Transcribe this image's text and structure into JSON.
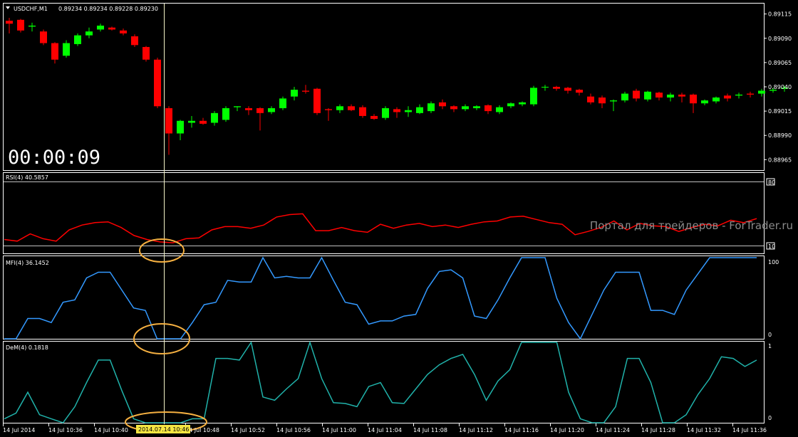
{
  "header": {
    "symbol": "USDCHF,M1",
    "ohlc": "0.89234 0.89234 0.89228 0.89230"
  },
  "timer": "00:00:09",
  "watermark": "Портал для трейдеров - ForTrader.ru",
  "crosshair_date": "2014.07.14 10:46",
  "colors": {
    "background": "#000000",
    "bull": "#00ff00",
    "bear": "#ff0000",
    "rsi": "#ff0000",
    "mfi": "#3399ff",
    "dem": "#20b2aa",
    "crosshair": "#f5f5c8",
    "highlight": "#f5b041"
  },
  "price_axis": [
    "0.89115",
    "0.89090",
    "0.89065",
    "0.89040",
    "0.89015",
    "0.88990",
    "0.88965"
  ],
  "time_axis": [
    "14 Jul 2014",
    "14 Jul 10:36",
    "14 Jul 10:40",
    "14 Jul 10:48",
    "14 Jul 10:52",
    "14 Jul 10:56",
    "14 Jul 11:00",
    "14 Jul 11:04",
    "14 Jul 11:08",
    "14 Jul 11:12",
    "14 Jul 11:16",
    "14 Jul 11:20",
    "14 Jul 11:24",
    "14 Jul 11:28",
    "14 Jul 11:32",
    "14 Jul 11:36"
  ],
  "rsi": {
    "label": "RSI(4) 40.5857",
    "levels": [
      "80",
      "10"
    ]
  },
  "mfi": {
    "label": "MFI(4) 36.1452",
    "levels": [
      "100",
      "0"
    ]
  },
  "dem": {
    "label": "DeM(4) 0.1818",
    "levels": [
      "1",
      "0"
    ]
  },
  "chart_data": [
    {
      "type": "candlestick",
      "title": "USDCHF,M1",
      "ylim": [
        0.88955,
        0.89125
      ],
      "candles": [
        {
          "o": 0.89108,
          "h": 0.89111,
          "l": 0.89095,
          "c": 0.89105
        },
        {
          "o": 0.89109,
          "h": 0.8911,
          "l": 0.89096,
          "c": 0.89098
        },
        {
          "o": 0.89102,
          "h": 0.89106,
          "l": 0.89097,
          "c": 0.89103
        },
        {
          "o": 0.89097,
          "h": 0.89099,
          "l": 0.89083,
          "c": 0.89085
        },
        {
          "o": 0.89085,
          "h": 0.89086,
          "l": 0.89064,
          "c": 0.89068
        },
        {
          "o": 0.89072,
          "h": 0.89088,
          "l": 0.8907,
          "c": 0.89085
        },
        {
          "o": 0.89084,
          "h": 0.89095,
          "l": 0.89082,
          "c": 0.89093
        },
        {
          "o": 0.89093,
          "h": 0.89101,
          "l": 0.8909,
          "c": 0.89097
        },
        {
          "o": 0.89099,
          "h": 0.89105,
          "l": 0.89097,
          "c": 0.89103
        },
        {
          "o": 0.89101,
          "h": 0.89102,
          "l": 0.89098,
          "c": 0.89099
        },
        {
          "o": 0.89098,
          "h": 0.891,
          "l": 0.89093,
          "c": 0.89095
        },
        {
          "o": 0.89092,
          "h": 0.89094,
          "l": 0.89081,
          "c": 0.89083
        },
        {
          "o": 0.89081,
          "h": 0.89082,
          "l": 0.89066,
          "c": 0.89068
        },
        {
          "o": 0.89068,
          "h": 0.8907,
          "l": 0.89018,
          "c": 0.8902
        },
        {
          "o": 0.89018,
          "h": 0.8902,
          "l": 0.8897,
          "c": 0.88992
        },
        {
          "o": 0.88992,
          "h": 0.89006,
          "l": 0.88985,
          "c": 0.89005
        },
        {
          "o": 0.89003,
          "h": 0.8901,
          "l": 0.88998,
          "c": 0.89005
        },
        {
          "o": 0.89005,
          "h": 0.89008,
          "l": 0.89001,
          "c": 0.89002
        },
        {
          "o": 0.89003,
          "h": 0.89015,
          "l": 0.89,
          "c": 0.89013
        },
        {
          "o": 0.89006,
          "h": 0.8902,
          "l": 0.89004,
          "c": 0.89018
        },
        {
          "o": 0.89019,
          "h": 0.8902,
          "l": 0.89015,
          "c": 0.8902
        },
        {
          "o": 0.89018,
          "h": 0.8902,
          "l": 0.89011,
          "c": 0.89016
        },
        {
          "o": 0.89018,
          "h": 0.89019,
          "l": 0.88995,
          "c": 0.89013
        },
        {
          "o": 0.89014,
          "h": 0.8902,
          "l": 0.89012,
          "c": 0.89018
        },
        {
          "o": 0.89018,
          "h": 0.8903,
          "l": 0.89016,
          "c": 0.89028
        },
        {
          "o": 0.8903,
          "h": 0.8904,
          "l": 0.89026,
          "c": 0.89037
        },
        {
          "o": 0.89036,
          "h": 0.89042,
          "l": 0.89033,
          "c": 0.89035
        },
        {
          "o": 0.89038,
          "h": 0.89039,
          "l": 0.89011,
          "c": 0.89013
        },
        {
          "o": 0.89017,
          "h": 0.89018,
          "l": 0.89005,
          "c": 0.89016
        },
        {
          "o": 0.89016,
          "h": 0.89022,
          "l": 0.89013,
          "c": 0.8902
        },
        {
          "o": 0.8902,
          "h": 0.89022,
          "l": 0.89015,
          "c": 0.89016
        },
        {
          "o": 0.89019,
          "h": 0.89021,
          "l": 0.89008,
          "c": 0.8901
        },
        {
          "o": 0.8901,
          "h": 0.89012,
          "l": 0.89006,
          "c": 0.89007
        },
        {
          "o": 0.89008,
          "h": 0.8902,
          "l": 0.89006,
          "c": 0.89018
        },
        {
          "o": 0.89017,
          "h": 0.89019,
          "l": 0.89008,
          "c": 0.89014
        },
        {
          "o": 0.89014,
          "h": 0.8902,
          "l": 0.89009,
          "c": 0.89016
        },
        {
          "o": 0.89013,
          "h": 0.89022,
          "l": 0.89012,
          "c": 0.89019
        },
        {
          "o": 0.89015,
          "h": 0.89025,
          "l": 0.89013,
          "c": 0.89023
        },
        {
          "o": 0.89024,
          "h": 0.89027,
          "l": 0.89017,
          "c": 0.8902
        },
        {
          "o": 0.8902,
          "h": 0.89021,
          "l": 0.89014,
          "c": 0.89017
        },
        {
          "o": 0.89017,
          "h": 0.89022,
          "l": 0.89015,
          "c": 0.8902
        },
        {
          "o": 0.89018,
          "h": 0.89021,
          "l": 0.89016,
          "c": 0.8902
        },
        {
          "o": 0.89021,
          "h": 0.89022,
          "l": 0.89012,
          "c": 0.89015
        },
        {
          "o": 0.89014,
          "h": 0.89021,
          "l": 0.89012,
          "c": 0.89019
        },
        {
          "o": 0.8902,
          "h": 0.89024,
          "l": 0.89018,
          "c": 0.89023
        },
        {
          "o": 0.89022,
          "h": 0.89025,
          "l": 0.8902,
          "c": 0.89024
        },
        {
          "o": 0.89022,
          "h": 0.89041,
          "l": 0.8902,
          "c": 0.89039
        },
        {
          "o": 0.8904,
          "h": 0.89042,
          "l": 0.89036,
          "c": 0.8904
        },
        {
          "o": 0.8904,
          "h": 0.89041,
          "l": 0.89036,
          "c": 0.89038
        },
        {
          "o": 0.89039,
          "h": 0.8904,
          "l": 0.89033,
          "c": 0.89036
        },
        {
          "o": 0.89037,
          "h": 0.89038,
          "l": 0.89031,
          "c": 0.89034
        },
        {
          "o": 0.8903,
          "h": 0.89033,
          "l": 0.89022,
          "c": 0.89024
        },
        {
          "o": 0.89029,
          "h": 0.89031,
          "l": 0.89018,
          "c": 0.89023
        },
        {
          "o": 0.89025,
          "h": 0.89027,
          "l": 0.89015,
          "c": 0.89026
        },
        {
          "o": 0.89026,
          "h": 0.89035,
          "l": 0.89024,
          "c": 0.89033
        },
        {
          "o": 0.89036,
          "h": 0.89038,
          "l": 0.89025,
          "c": 0.89028
        },
        {
          "o": 0.89027,
          "h": 0.89036,
          "l": 0.89025,
          "c": 0.89035
        },
        {
          "o": 0.89034,
          "h": 0.89035,
          "l": 0.89026,
          "c": 0.89029
        },
        {
          "o": 0.89029,
          "h": 0.89034,
          "l": 0.89025,
          "c": 0.89032
        },
        {
          "o": 0.89032,
          "h": 0.89034,
          "l": 0.89024,
          "c": 0.8903
        },
        {
          "o": 0.89032,
          "h": 0.89033,
          "l": 0.89013,
          "c": 0.89023
        },
        {
          "o": 0.89023,
          "h": 0.89027,
          "l": 0.89021,
          "c": 0.89026
        },
        {
          "o": 0.89025,
          "h": 0.8903,
          "l": 0.89023,
          "c": 0.89029
        },
        {
          "o": 0.89031,
          "h": 0.89033,
          "l": 0.89025,
          "c": 0.89028
        },
        {
          "o": 0.89031,
          "h": 0.89034,
          "l": 0.89028,
          "c": 0.89032
        },
        {
          "o": 0.89033,
          "h": 0.89035,
          "l": 0.89029,
          "c": 0.89032
        },
        {
          "o": 0.89033,
          "h": 0.89038,
          "l": 0.8903,
          "c": 0.89036
        },
        {
          "o": 0.89036,
          "h": 0.89039,
          "l": 0.89034,
          "c": 0.89037
        },
        {
          "o": 0.89038,
          "h": 0.89041,
          "l": 0.89035,
          "c": 0.89039
        }
      ]
    },
    {
      "type": "line",
      "title": "RSI(4) 40.5857",
      "ylim": [
        0,
        100
      ],
      "values": [
        19,
        17,
        26,
        20,
        17,
        31,
        37,
        40,
        41,
        34,
        24,
        19,
        16,
        15,
        20,
        21,
        31,
        35,
        35,
        33,
        37,
        47,
        50,
        51,
        30,
        30,
        34,
        30,
        28,
        38,
        33,
        37,
        39,
        35,
        37,
        34,
        38,
        41,
        42,
        47,
        48,
        44,
        40,
        38,
        25,
        29,
        34,
        42,
        31,
        39,
        36,
        35,
        29,
        34,
        38,
        36,
        43,
        40,
        45
      ],
      "levels": [
        80,
        10
      ]
    },
    {
      "type": "line",
      "title": "MFI(4) 36.1452",
      "ylim": [
        0,
        100
      ],
      "values": [
        0,
        0,
        25,
        25,
        20,
        45,
        48,
        75,
        82,
        82,
        60,
        38,
        35,
        0,
        0,
        0,
        20,
        42,
        45,
        72,
        70,
        70,
        100,
        75,
        77,
        75,
        75,
        100,
        72,
        45,
        42,
        18,
        22,
        22,
        28,
        30,
        62,
        83,
        85,
        75,
        28,
        25,
        48,
        75,
        100,
        100,
        100,
        50,
        20,
        0,
        30,
        60,
        82,
        82,
        82,
        35,
        35,
        30,
        60,
        80,
        100,
        100,
        100,
        100,
        100
      ],
      "levels": [
        100,
        0
      ]
    },
    {
      "type": "line",
      "title": "DeM(4) 0.1818",
      "ylim": [
        0,
        1
      ],
      "values": [
        0.05,
        0.12,
        0.38,
        0.1,
        0.05,
        0.0,
        0.2,
        0.5,
        0.78,
        0.78,
        0.4,
        0.05,
        0.0,
        0.0,
        0.0,
        0.0,
        0.05,
        0.05,
        0.8,
        0.8,
        0.78,
        1.0,
        0.32,
        0.28,
        0.42,
        0.55,
        1.0,
        0.55,
        0.25,
        0.24,
        0.2,
        0.45,
        0.5,
        0.25,
        0.24,
        0.42,
        0.6,
        0.72,
        0.8,
        0.85,
        0.6,
        0.28,
        0.52,
        0.66,
        1.0,
        1.0,
        1.0,
        1.0,
        0.38,
        0.05,
        0.0,
        0.0,
        0.2,
        0.8,
        0.8,
        0.5,
        0.0,
        0.0,
        0.1,
        0.35,
        0.55,
        0.82,
        0.8,
        0.7,
        0.78
      ],
      "levels": [
        1,
        0
      ]
    }
  ]
}
